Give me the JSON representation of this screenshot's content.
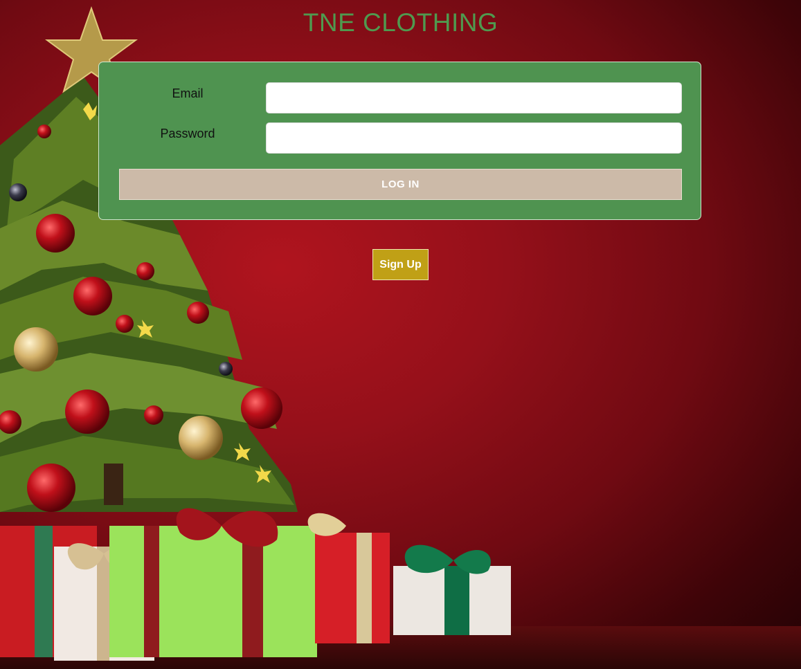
{
  "brand": {
    "title": "TNE CLOTHING",
    "title_color": "#4f9a4f"
  },
  "login_form": {
    "email_label": "Email",
    "email_value": "",
    "password_label": "Password",
    "password_value": "",
    "login_label": "LOG IN",
    "panel_color": "#4f9350",
    "login_button_color": "#ccbaa8"
  },
  "signup": {
    "label": "Sign Up",
    "button_color": "#c0a016"
  },
  "background": {
    "base_color": "#95101a",
    "scene": "christmas-tree-with-gifts"
  }
}
